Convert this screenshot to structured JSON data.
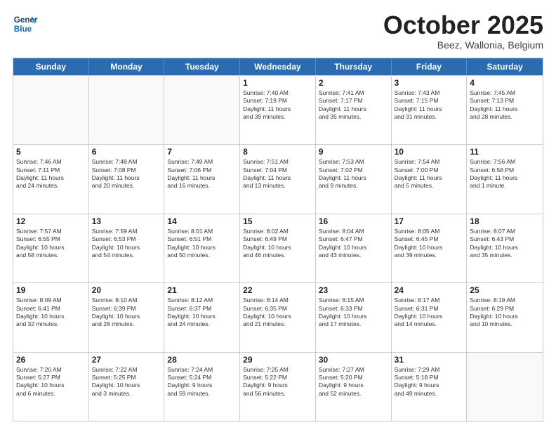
{
  "header": {
    "logo_line1": "General",
    "logo_line2": "Blue",
    "month": "October 2025",
    "location": "Beez, Wallonia, Belgium"
  },
  "weekdays": [
    "Sunday",
    "Monday",
    "Tuesday",
    "Wednesday",
    "Thursday",
    "Friday",
    "Saturday"
  ],
  "weeks": [
    [
      {
        "day": "",
        "info": ""
      },
      {
        "day": "",
        "info": ""
      },
      {
        "day": "",
        "info": ""
      },
      {
        "day": "1",
        "info": "Sunrise: 7:40 AM\nSunset: 7:19 PM\nDaylight: 11 hours\nand 39 minutes."
      },
      {
        "day": "2",
        "info": "Sunrise: 7:41 AM\nSunset: 7:17 PM\nDaylight: 11 hours\nand 35 minutes."
      },
      {
        "day": "3",
        "info": "Sunrise: 7:43 AM\nSunset: 7:15 PM\nDaylight: 11 hours\nand 31 minutes."
      },
      {
        "day": "4",
        "info": "Sunrise: 7:45 AM\nSunset: 7:13 PM\nDaylight: 11 hours\nand 28 minutes."
      }
    ],
    [
      {
        "day": "5",
        "info": "Sunrise: 7:46 AM\nSunset: 7:11 PM\nDaylight: 11 hours\nand 24 minutes."
      },
      {
        "day": "6",
        "info": "Sunrise: 7:48 AM\nSunset: 7:08 PM\nDaylight: 11 hours\nand 20 minutes."
      },
      {
        "day": "7",
        "info": "Sunrise: 7:49 AM\nSunset: 7:06 PM\nDaylight: 11 hours\nand 16 minutes."
      },
      {
        "day": "8",
        "info": "Sunrise: 7:51 AM\nSunset: 7:04 PM\nDaylight: 11 hours\nand 13 minutes."
      },
      {
        "day": "9",
        "info": "Sunrise: 7:53 AM\nSunset: 7:02 PM\nDaylight: 11 hours\nand 9 minutes."
      },
      {
        "day": "10",
        "info": "Sunrise: 7:54 AM\nSunset: 7:00 PM\nDaylight: 11 hours\nand 5 minutes."
      },
      {
        "day": "11",
        "info": "Sunrise: 7:56 AM\nSunset: 6:58 PM\nDaylight: 11 hours\nand 1 minute."
      }
    ],
    [
      {
        "day": "12",
        "info": "Sunrise: 7:57 AM\nSunset: 6:55 PM\nDaylight: 10 hours\nand 58 minutes."
      },
      {
        "day": "13",
        "info": "Sunrise: 7:59 AM\nSunset: 6:53 PM\nDaylight: 10 hours\nand 54 minutes."
      },
      {
        "day": "14",
        "info": "Sunrise: 8:01 AM\nSunset: 6:51 PM\nDaylight: 10 hours\nand 50 minutes."
      },
      {
        "day": "15",
        "info": "Sunrise: 8:02 AM\nSunset: 6:49 PM\nDaylight: 10 hours\nand 46 minutes."
      },
      {
        "day": "16",
        "info": "Sunrise: 8:04 AM\nSunset: 6:47 PM\nDaylight: 10 hours\nand 43 minutes."
      },
      {
        "day": "17",
        "info": "Sunrise: 8:05 AM\nSunset: 6:45 PM\nDaylight: 10 hours\nand 39 minutes."
      },
      {
        "day": "18",
        "info": "Sunrise: 8:07 AM\nSunset: 6:43 PM\nDaylight: 10 hours\nand 35 minutes."
      }
    ],
    [
      {
        "day": "19",
        "info": "Sunrise: 8:09 AM\nSunset: 6:41 PM\nDaylight: 10 hours\nand 32 minutes."
      },
      {
        "day": "20",
        "info": "Sunrise: 8:10 AM\nSunset: 6:39 PM\nDaylight: 10 hours\nand 28 minutes."
      },
      {
        "day": "21",
        "info": "Sunrise: 8:12 AM\nSunset: 6:37 PM\nDaylight: 10 hours\nand 24 minutes."
      },
      {
        "day": "22",
        "info": "Sunrise: 8:14 AM\nSunset: 6:35 PM\nDaylight: 10 hours\nand 21 minutes."
      },
      {
        "day": "23",
        "info": "Sunrise: 8:15 AM\nSunset: 6:33 PM\nDaylight: 10 hours\nand 17 minutes."
      },
      {
        "day": "24",
        "info": "Sunrise: 8:17 AM\nSunset: 6:31 PM\nDaylight: 10 hours\nand 14 minutes."
      },
      {
        "day": "25",
        "info": "Sunrise: 8:19 AM\nSunset: 6:29 PM\nDaylight: 10 hours\nand 10 minutes."
      }
    ],
    [
      {
        "day": "26",
        "info": "Sunrise: 7:20 AM\nSunset: 5:27 PM\nDaylight: 10 hours\nand 6 minutes."
      },
      {
        "day": "27",
        "info": "Sunrise: 7:22 AM\nSunset: 5:25 PM\nDaylight: 10 hours\nand 3 minutes."
      },
      {
        "day": "28",
        "info": "Sunrise: 7:24 AM\nSunset: 5:24 PM\nDaylight: 9 hours\nand 59 minutes."
      },
      {
        "day": "29",
        "info": "Sunrise: 7:25 AM\nSunset: 5:22 PM\nDaylight: 9 hours\nand 56 minutes."
      },
      {
        "day": "30",
        "info": "Sunrise: 7:27 AM\nSunset: 5:20 PM\nDaylight: 9 hours\nand 52 minutes."
      },
      {
        "day": "31",
        "info": "Sunrise: 7:29 AM\nSunset: 5:18 PM\nDaylight: 9 hours\nand 49 minutes."
      },
      {
        "day": "",
        "info": ""
      }
    ]
  ]
}
